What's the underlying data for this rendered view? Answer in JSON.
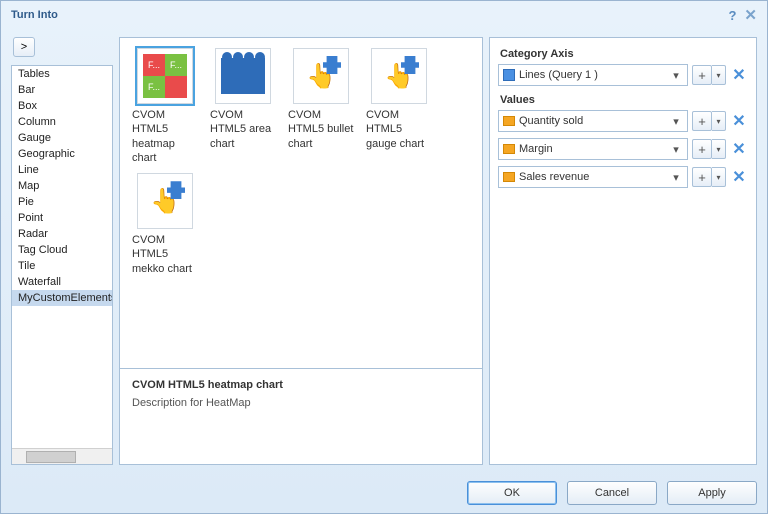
{
  "title": "Turn Into",
  "sidebar": {
    "items": [
      {
        "label": "Tables"
      },
      {
        "label": "Bar"
      },
      {
        "label": "Box"
      },
      {
        "label": "Column"
      },
      {
        "label": "Gauge"
      },
      {
        "label": "Geographic"
      },
      {
        "label": "Line"
      },
      {
        "label": "Map"
      },
      {
        "label": "Pie"
      },
      {
        "label": "Point"
      },
      {
        "label": "Radar"
      },
      {
        "label": "Tag Cloud"
      },
      {
        "label": "Tile"
      },
      {
        "label": "Waterfall"
      },
      {
        "label": "MyCustomElements"
      }
    ],
    "selected_index": 14
  },
  "charts": {
    "items": [
      {
        "label": "CVOM HTML5 heatmap chart",
        "icon": "heatmap",
        "selected": true
      },
      {
        "label": "CVOM HTML5 area chart",
        "icon": "area"
      },
      {
        "label": "CVOM HTML5 bullet chart",
        "icon": "puzzle"
      },
      {
        "label": "CVOM HTML5 gauge chart",
        "icon": "puzzle"
      },
      {
        "label": "CVOM HTML5 mekko chart",
        "icon": "puzzle"
      }
    ]
  },
  "description": {
    "title": "CVOM HTML5 heatmap chart",
    "text": "Description for HeatMap"
  },
  "right_panel": {
    "category_label": "Category Axis",
    "category_value": "Lines (Query 1 )",
    "values_label": "Values",
    "values": [
      {
        "label": "Quantity sold"
      },
      {
        "label": "Margin"
      },
      {
        "label": "Sales revenue"
      }
    ]
  },
  "buttons": {
    "ok": "OK",
    "cancel": "Cancel",
    "apply": "Apply",
    "expand": ">"
  },
  "heatmap_cells": [
    "F...",
    "F...",
    "F...",
    ""
  ]
}
